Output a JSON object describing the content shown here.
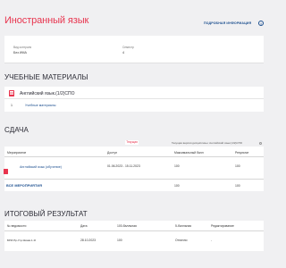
{
  "page": {
    "title": "Иностранный язык",
    "info_link": "ПОДРОБНАЯ ИНФОРМАЦИЯ"
  },
  "meta": {
    "kind_label": "Вид контроля",
    "kind_value": "Без ИМА",
    "semester_label": "Семестр",
    "semester_value": "4"
  },
  "materials": {
    "title": "УЧЕБНЫЕ МАТЕРИАЛЫ",
    "course": "Английский язык.(1/2)СПО",
    "row_num": "1",
    "row_label": "Учебные материалы"
  },
  "submission": {
    "title": "СДАЧА",
    "badge": "Текущая",
    "version_text": "Текущая версия дисциплины: Английский язык.(1/2)СПО",
    "columns": [
      "Мероприятие",
      "Доступ",
      "Максимальный балл",
      "Результат"
    ],
    "row": {
      "event": "Английский язык (обучение)",
      "access": "01.06.2023 - 15.11.2023",
      "max": "100",
      "result": "100"
    },
    "total": {
      "label": "ВСЕ МЕРОПРИЯТИЯ",
      "max": "100",
      "result": "100"
    }
  },
  "final": {
    "title": "ИТОГОВЫЙ РЕЗУЛЬТАТ",
    "columns": [
      "№ ведомости",
      "Дата",
      "100-балльная",
      "5-балльная",
      "Редактирование"
    ],
    "row": {
      "number": "БРИ-Пр-Угр-Экзам.1-Я",
      "date": "28.10.2023",
      "score100": "100",
      "score5": "Отлично",
      "edit": "-"
    }
  },
  "colors": {
    "accent": "#e8344e",
    "link": "#1c4f8f",
    "background": "#f0f0f2"
  }
}
